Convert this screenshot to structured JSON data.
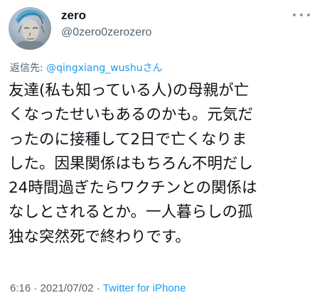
{
  "author": {
    "display_name": "zero",
    "handle": "@0zero0zerozero"
  },
  "reply": {
    "prefix": "返信先: ",
    "mention": "@qingxiang_wushu",
    "suffix": "さん"
  },
  "tweet": {
    "lines": [
      "友達(私も知っている人)の母親が亡",
      "くなったせいもあるのかも。元気だ",
      "ったのに接種して2日で亡くなりま",
      "した。因果関係はもちろん不明だし",
      "24時間過ぎたらワクチンとの関係は",
      "なしとされるとか。一人暮らしの孤",
      "独な突然死で終わりです。"
    ]
  },
  "meta": {
    "time": "6:16",
    "separator": " · ",
    "date": "2021/07/02",
    "source": "Twitter for iPhone"
  },
  "icons": {
    "more": "more-horizontal-icon",
    "avatar": "profile-avatar"
  },
  "colors": {
    "text": "#0f1419",
    "secondary": "#536471",
    "link": "#1d9bf0"
  }
}
